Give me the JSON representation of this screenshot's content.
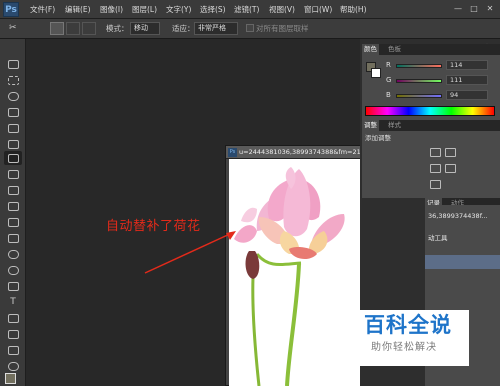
{
  "app": {
    "logo": "Ps"
  },
  "menubar": {
    "items": [
      "文件(F)",
      "编辑(E)",
      "图像(I)",
      "图层(L)",
      "文字(Y)",
      "选择(S)",
      "滤镜(T)",
      "视图(V)",
      "窗口(W)",
      "帮助(H)"
    ],
    "window_controls": {
      "minimize": "—",
      "restore": "□",
      "close": "✕"
    }
  },
  "options": {
    "mode_label": "模式：",
    "mode_value": "移动",
    "adapt_label": "适应：",
    "adapt_value": "非常严格",
    "sample_all_label": "对所有图层取样"
  },
  "document": {
    "title": "u=2444381036,3899374388&fm=21...",
    "photo_description_icon": "lotus-photo"
  },
  "annotation": {
    "text": "自动替补了荷花",
    "color": "#e32a1a"
  },
  "panels": {
    "color_tabs": [
      "颜色",
      "色板"
    ],
    "rgb": [
      {
        "label": "R",
        "value": "114"
      },
      {
        "label": "G",
        "value": "111"
      },
      {
        "label": "B",
        "value": "94"
      }
    ],
    "foreground_color": "#726f5e",
    "adjust_tabs": [
      "调整",
      "样式"
    ],
    "adjust_title": "添加调整",
    "history_tabs": [
      "记录",
      "动作"
    ],
    "history_rows": [
      "36,3899374438f...",
      "动工具"
    ]
  },
  "watermark": {
    "title": "百科全说",
    "subtitle": "助你轻松解决"
  }
}
